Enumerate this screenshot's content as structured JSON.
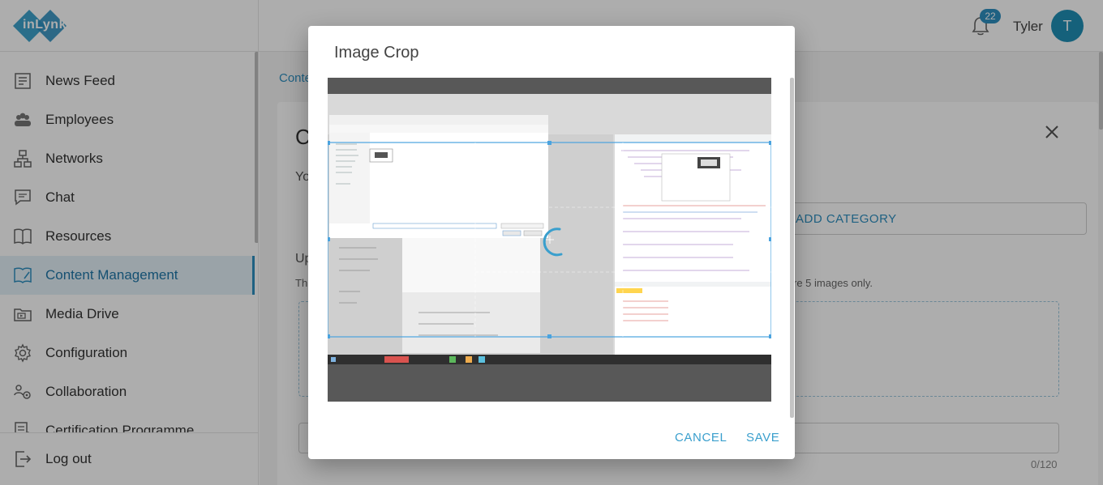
{
  "header": {
    "logo_text": "inLynk",
    "notification_count": "22",
    "user_name": "Tyler",
    "avatar_initial": "T"
  },
  "sidebar": {
    "items": [
      {
        "label": "News Feed",
        "icon": "news-feed-icon"
      },
      {
        "label": "Employees",
        "icon": "employees-icon"
      },
      {
        "label": "Networks",
        "icon": "networks-icon"
      },
      {
        "label": "Chat",
        "icon": "chat-icon"
      },
      {
        "label": "Resources",
        "icon": "resources-icon"
      },
      {
        "label": "Content Management",
        "icon": "content-management-icon",
        "active": true
      },
      {
        "label": "Media Drive",
        "icon": "media-drive-icon"
      },
      {
        "label": "Configuration",
        "icon": "gear-icon"
      },
      {
        "label": "Collaboration",
        "icon": "collaboration-icon"
      },
      {
        "label": "Certification Programme",
        "icon": "certification-icon"
      }
    ],
    "logout_label": "Log out"
  },
  "main": {
    "breadcrumb": "Conte",
    "card_title": "C",
    "subtitle": "Yo",
    "add_category_label": "ADD CATEGORY",
    "upload_heading": "Up",
    "upload_note_start": "Th",
    "upload_note_end": "re 5 images only.",
    "char_counter": "0/120"
  },
  "dialog": {
    "title": "Image Crop",
    "cancel_label": "CANCEL",
    "save_label": "SAVE"
  },
  "colors": {
    "accent": "#2e8fc0",
    "active_bg": "#e4f1f8",
    "button_text": "#3a9fcd"
  }
}
